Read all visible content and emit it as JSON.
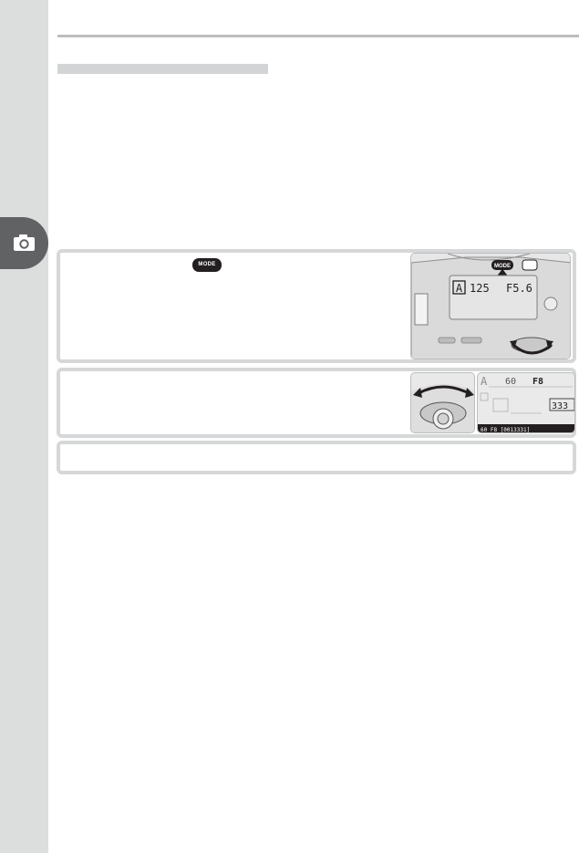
{
  "page": {
    "header": {
      "title": ""
    },
    "section_heading": ""
  },
  "sidebar": {
    "tab_icon": "camera-icon"
  },
  "steps": [
    {
      "text": "",
      "button": {
        "label": "MODE",
        "icon": "mode-button-icon"
      },
      "illustration": {
        "icon": "camera-top-mode-button-illustration",
        "lcd": {
          "mode": "A",
          "shutter": "125",
          "aperture": "F5.6"
        },
        "button_label": "MODE"
      }
    },
    {
      "text": "",
      "dial_illustration": {
        "icon": "sub-command-dial-illustration"
      },
      "lcd_illustration": {
        "icon": "control-panel-lcd-illustration",
        "mode": "A",
        "shutter": "60",
        "aperture": "F8",
        "frames": "333",
        "viewfinder_row": "60  F8        [0013331]"
      }
    },
    {
      "text": ""
    }
  ]
}
